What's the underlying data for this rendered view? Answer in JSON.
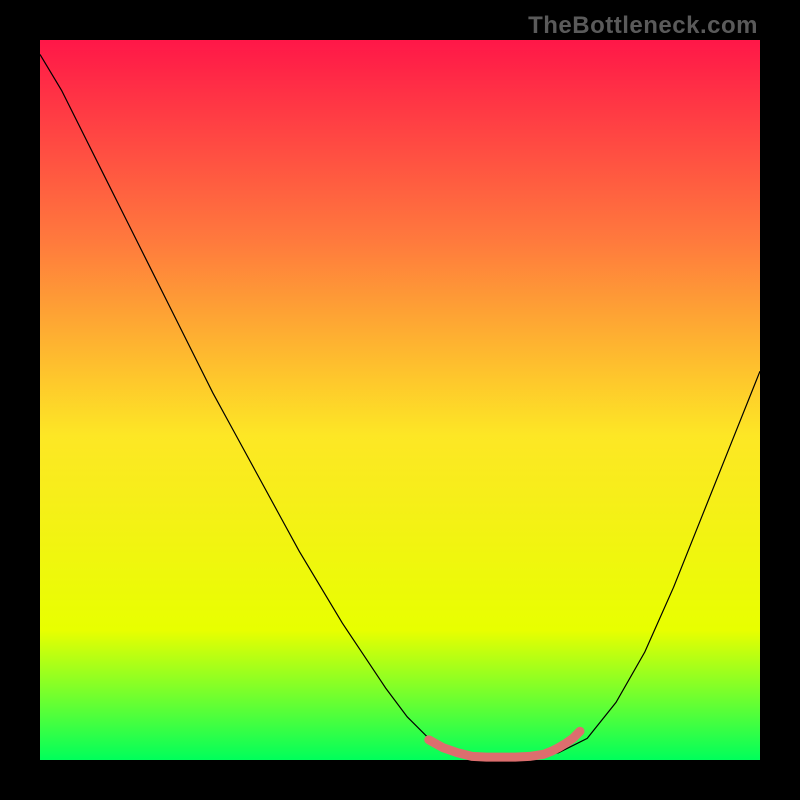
{
  "watermark": "TheBottleneck.com",
  "chart_data": {
    "type": "line",
    "title": "",
    "xlabel": "",
    "ylabel": "",
    "xlim": [
      0,
      100
    ],
    "ylim": [
      0,
      100
    ],
    "gradient_colors": {
      "top": "#FF1748",
      "upper_mid": "#FF7A3D",
      "mid": "#FDE725",
      "lower_mid": "#E8FF00",
      "bottom": "#00FF5B"
    },
    "series": [
      {
        "name": "curve",
        "color": "#000000",
        "stroke_width": 1.2,
        "x": [
          0,
          3,
          6,
          9,
          12,
          15,
          18,
          21,
          24,
          27,
          30,
          33,
          36,
          39,
          42,
          45,
          48,
          51,
          54,
          57,
          60,
          63,
          66,
          69,
          72,
          76,
          80,
          84,
          88,
          92,
          96,
          100
        ],
        "y": [
          98,
          93,
          87,
          81,
          75,
          69,
          63,
          57,
          51,
          45.5,
          40,
          34.5,
          29,
          24,
          19,
          14.5,
          10,
          6,
          3,
          1.2,
          0.5,
          0.4,
          0.4,
          0.5,
          1,
          3,
          8,
          15,
          24,
          34,
          44,
          54
        ]
      },
      {
        "name": "highlight-segment",
        "color": "#DC6E6E",
        "stroke_width": 9,
        "linecap": "round",
        "x": [
          54,
          56,
          58,
          60,
          62,
          64,
          66,
          68,
          70,
          71,
          72,
          73,
          74,
          75
        ],
        "y": [
          2.8,
          1.7,
          1.0,
          0.5,
          0.4,
          0.4,
          0.4,
          0.5,
          0.8,
          1.2,
          1.7,
          2.3,
          3.0,
          4.0
        ]
      }
    ]
  }
}
